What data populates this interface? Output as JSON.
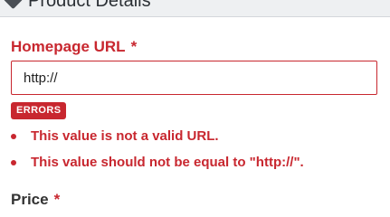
{
  "panel": {
    "title": "Product Details",
    "icon": "cube-icon"
  },
  "homepage_url": {
    "label": "Homepage URL",
    "required_marker": "*",
    "value": "http://",
    "errors_badge": "ERRORS",
    "errors": [
      "This value is not a valid URL.",
      "This value should not be equal to \"http://\"."
    ]
  },
  "price": {
    "label": "Price",
    "required_marker": "*"
  },
  "colors": {
    "error": "#c8272f",
    "label": "#333333",
    "header_bg": "#eef0f2"
  }
}
